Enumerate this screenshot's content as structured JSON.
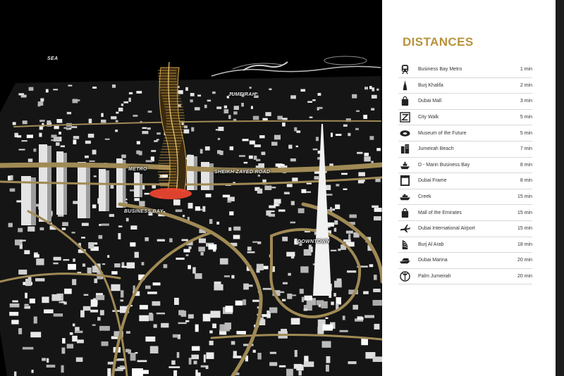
{
  "map": {
    "labels": {
      "sea": "SEA",
      "jumeirah": "JUMEIRAH",
      "metro": "METRO",
      "sheikh_zayed_road": "SHEIKH ZAYED ROAD",
      "business_bay": "BUSINESS BAY",
      "downtown": "DOWNTOWN"
    },
    "colors": {
      "road": "#a08a55",
      "building": "#e6e6e6",
      "ground": "#1a1a1a",
      "tower": "#c9a04e",
      "marker": "#e8452f"
    }
  },
  "panel": {
    "title": "DISTANCES",
    "accent_color": "#b8923c",
    "items": [
      {
        "icon": "metro-icon",
        "name": "Business Bay Metro",
        "time": "1 min"
      },
      {
        "icon": "burj-khalifa-icon",
        "name": "Burj Khalifa",
        "time": "2 min"
      },
      {
        "icon": "shopping-bag-icon",
        "name": "Dubai Mall",
        "time": "3 min"
      },
      {
        "icon": "city-walk-icon",
        "name": "City Walk",
        "time": "5 min"
      },
      {
        "icon": "museum-icon",
        "name": "Museum of the Future",
        "time": "5 min"
      },
      {
        "icon": "buildings-icon",
        "name": "Jumeirah Beach",
        "time": "7  min"
      },
      {
        "icon": "boat-icon",
        "name": "D - Marin Business Bay",
        "time": "8  min"
      },
      {
        "icon": "frame-icon",
        "name": "Dubai Frame",
        "time": "8  min"
      },
      {
        "icon": "ship-icon",
        "name": "Creek",
        "time": "15 min"
      },
      {
        "icon": "shopping-bag-icon",
        "name": "Mall of the Emirates",
        "time": "15 min"
      },
      {
        "icon": "airplane-icon",
        "name": "Dubai International Airport",
        "time": "15 min"
      },
      {
        "icon": "burj-al-arab-icon",
        "name": "Burj Al Arab",
        "time": "18 min"
      },
      {
        "icon": "yacht-icon",
        "name": "Dubai Marina",
        "time": "20 min"
      },
      {
        "icon": "palm-icon",
        "name": "Palm Jumeirah",
        "time": "20 min"
      }
    ]
  }
}
